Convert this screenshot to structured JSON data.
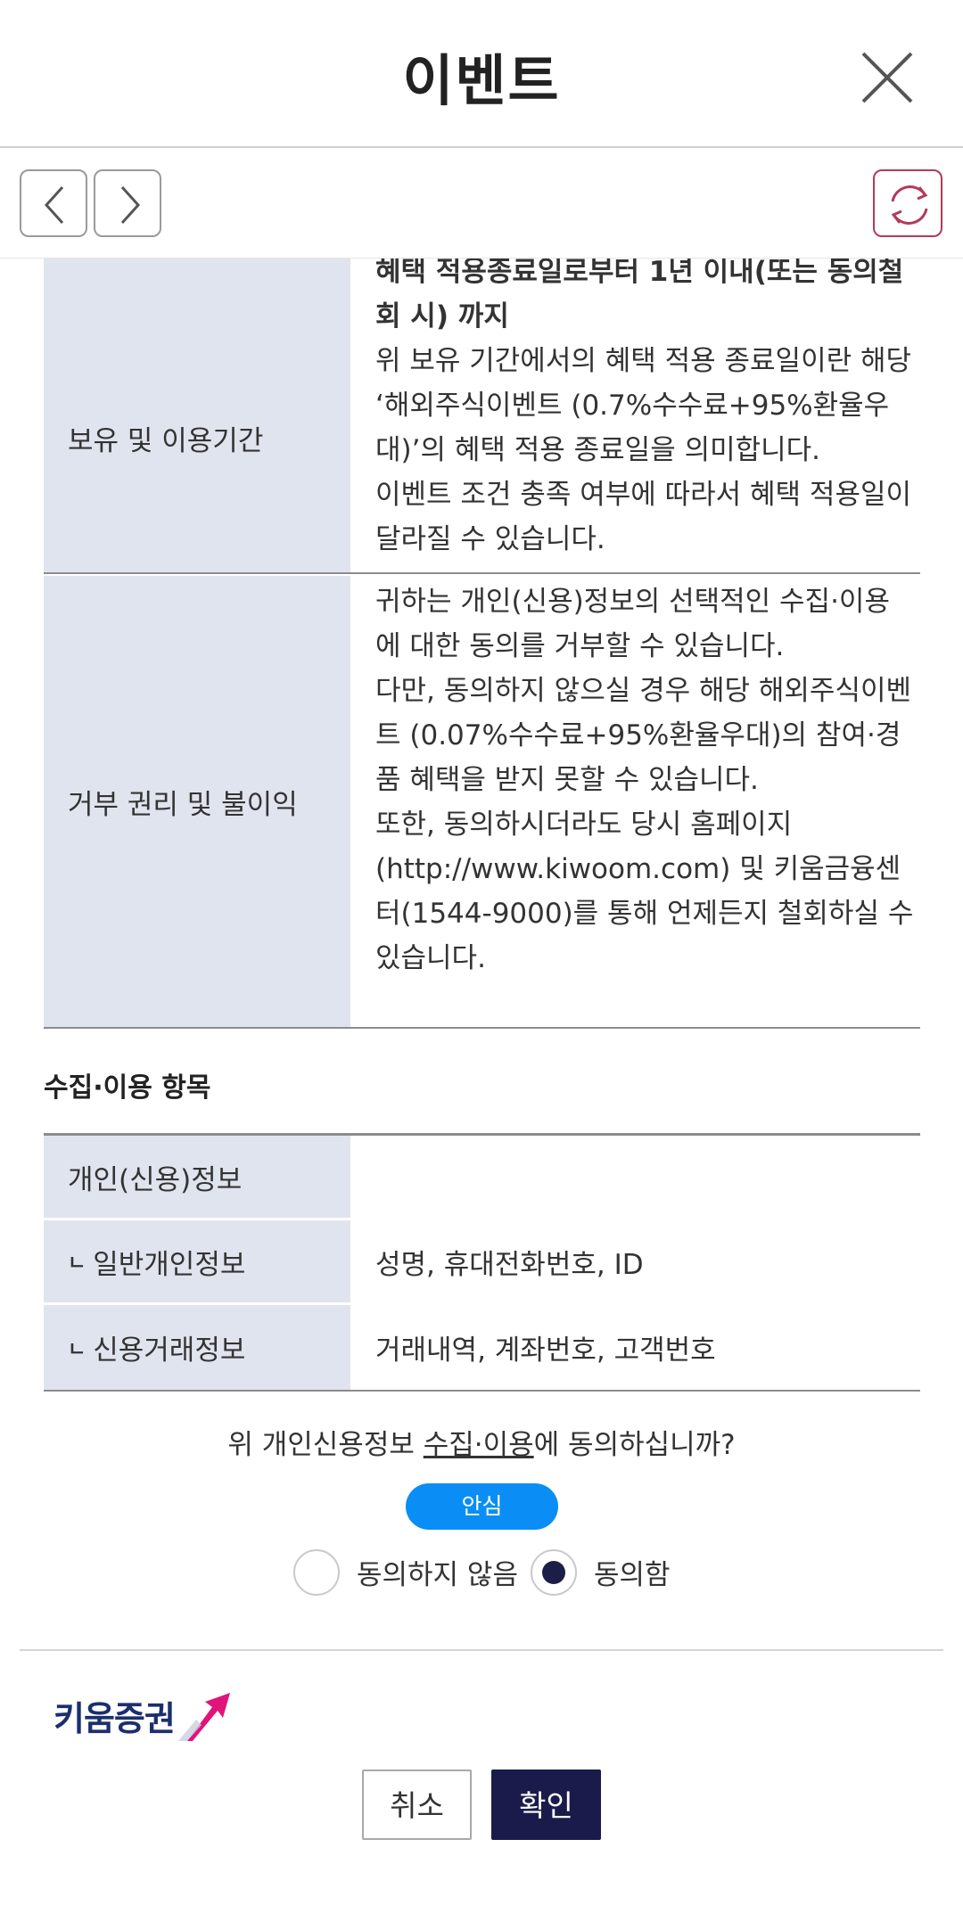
{
  "header": {
    "title": "이벤트",
    "close_icon": "close-icon"
  },
  "navbar": {
    "back_icon": "chevron-left-icon",
    "forward_icon": "chevron-right-icon",
    "refresh_icon": "refresh-icon"
  },
  "info_rows": [
    {
      "label": "보유 및 이용기간",
      "bold_lines": [
        "혜택 적용종료일로부터 1년 이내(또는 동의철",
        "회 시) 까지"
      ],
      "lines": [
        "위 보유 기간에서의 혜택 적용 종료일이란 해당",
        "‘해외주식이벤트 (0.7%수수료+95%환율우",
        "대)’의 혜택 적용 종료일을 의미합니다.",
        "이벤트 조건 충족 여부에 따라서 혜택 적용일이",
        "달라질 수 있습니다."
      ]
    },
    {
      "label": "거부 권리 및 불이익",
      "lines": [
        "귀하는 개인(신용)정보의 선택적인 수집·이용",
        "에 대한 동의를 거부할 수 있습니다.",
        "다만, 동의하지 않으실 경우 해당 해외주식이벤",
        "트 (0.07%수수료+95%환율우대)의 참여·경",
        "품 혜택을 받지 못할 수 있습니다.",
        "또한, 동의하시더라도 당시 홈페이지",
        "(http://www.kiwoom.com) 및 키움금융센",
        "터(1544-9000)를 통해 언제든지 철회하실 수",
        "있습니다."
      ]
    }
  ],
  "items_section": {
    "title": "수집·이용 항목",
    "rows": [
      {
        "label": "개인(신용)정보",
        "value": "",
        "sub": false
      },
      {
        "label": "일반개인정보",
        "value": "성명, 휴대전화번호, ID",
        "sub": true
      },
      {
        "label": "신용거래정보",
        "value": "거래내역, 계좌번호, 고객번호",
        "sub": true
      }
    ],
    "sub_marker": "ㄴ"
  },
  "consent": {
    "question_prefix": "위 개인신용정보 ",
    "question_underlined": "수집·이용",
    "question_suffix": "에 동의하십니까?",
    "anshim_label": "안심",
    "options": [
      {
        "label": "동의하지 않음",
        "selected": false
      },
      {
        "label": "동의함",
        "selected": true
      }
    ]
  },
  "footer": {
    "logo_text": "키움증권",
    "cancel_label": "취소",
    "ok_label": "확인"
  },
  "colors": {
    "accent_navy": "#1b1b4b",
    "th_bg": "#e0e4ee",
    "anshim_blue": "#0a8ef5",
    "refresh_border": "#b23a5c",
    "logo_pink": "#e0147a"
  }
}
